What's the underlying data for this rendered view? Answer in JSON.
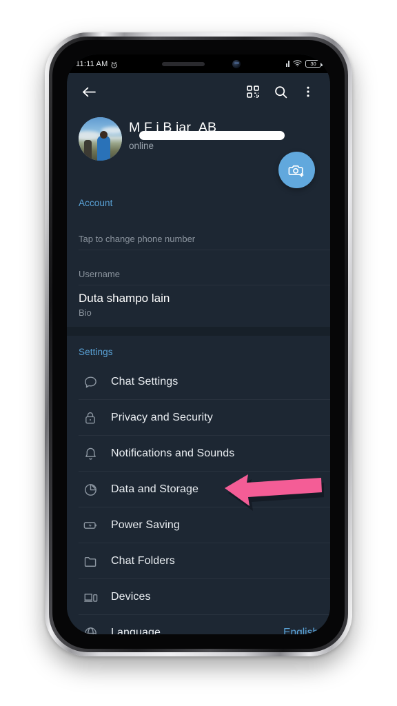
{
  "status_bar": {
    "time": "11:11 AM",
    "alarm_icon": "alarm-clock-icon",
    "signal_icon": "cellular-signal-icon",
    "wifi_icon": "wifi-icon",
    "battery_level": "30"
  },
  "app_bar": {
    "back_icon": "back-arrow-icon",
    "qr_icon": "qr-code-icon",
    "search_icon": "search-icon",
    "overflow_icon": "more-vertical-icon"
  },
  "profile": {
    "name": "M        F   i B    iar_AB",
    "status": "online",
    "avatar_icon": "profile-avatar",
    "camera_fab_icon": "add-photo-camera-icon"
  },
  "account_section": {
    "title": "Account",
    "items": [
      {
        "value": "",
        "label": "Tap to change phone number",
        "redacted": true
      },
      {
        "value": "",
        "label": "Username",
        "redacted": true
      },
      {
        "value": "Duta shampo lain",
        "label": "Bio",
        "redacted": false
      }
    ]
  },
  "settings_section": {
    "title": "Settings",
    "items": [
      {
        "label": "Chat Settings",
        "icon": "chat-bubble-icon",
        "value": ""
      },
      {
        "label": "Privacy and Security",
        "icon": "lock-icon",
        "value": ""
      },
      {
        "label": "Notifications and Sounds",
        "icon": "bell-icon",
        "value": ""
      },
      {
        "label": "Data and Storage",
        "icon": "pie-chart-icon",
        "value": ""
      },
      {
        "label": "Power Saving",
        "icon": "battery-bolt-icon",
        "value": ""
      },
      {
        "label": "Chat Folders",
        "icon": "folder-icon",
        "value": ""
      },
      {
        "label": "Devices",
        "icon": "devices-icon",
        "value": ""
      },
      {
        "label": "Language",
        "icon": "globe-icon",
        "value": "English"
      }
    ]
  },
  "annotation": {
    "arrow_icon": "pink-arrow-pointing-left",
    "arrow_color": "#F45D96",
    "points_at": "Data and Storage"
  },
  "theme": {
    "screen_background": "#1d2733",
    "accent_blue": "#5aa3d8",
    "fab_blue": "#61a8dd",
    "primary_text": "#e9edf1",
    "secondary_text": "#8b949e"
  }
}
